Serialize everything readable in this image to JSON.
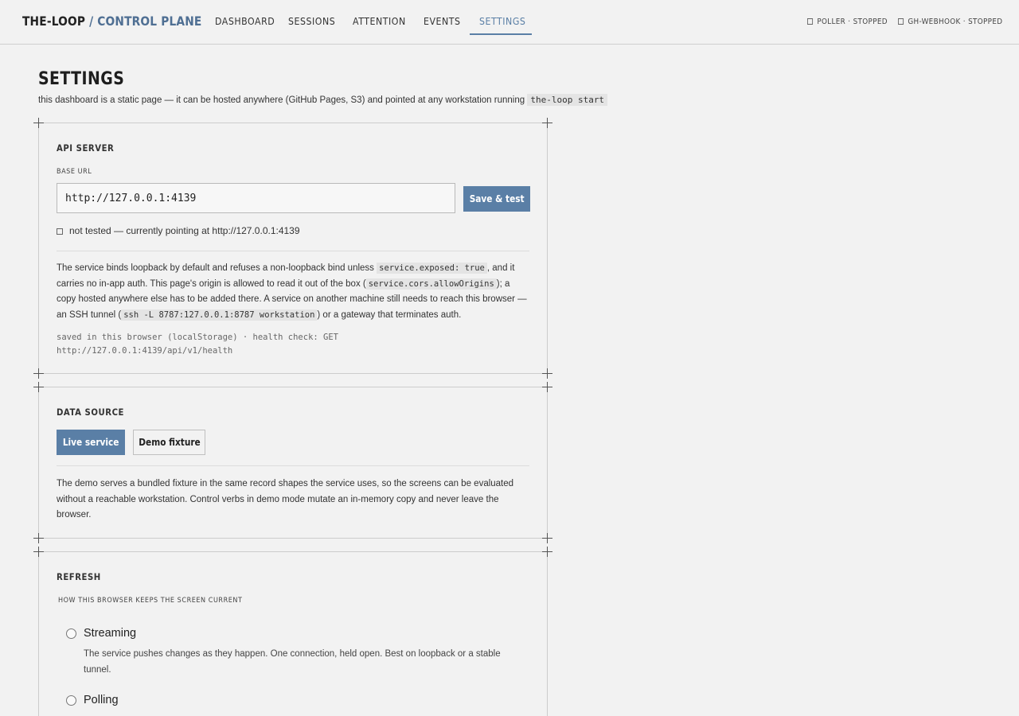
{
  "header": {
    "brand_main": "THE-LOOP",
    "brand_accent": "/ CONTROL PLANE",
    "nav": [
      "DASHBOARD",
      "SESSIONS",
      "ATTENTION",
      "EVENTS",
      "SETTINGS"
    ],
    "active_nav": "SETTINGS",
    "status": [
      "POLLER · STOPPED",
      "GH-WEBHOOK · STOPPED"
    ]
  },
  "page": {
    "title": "SETTINGS",
    "subtitle": "this dashboard is a static page — it can be hosted anywhere (GitHub Pages, S3) and pointed at any workstation running",
    "subtitle_code": "the-loop start"
  },
  "api_server": {
    "title": "API SERVER",
    "base_url_label": "BASE URL",
    "base_url_value": "http://127.0.0.1:4139",
    "save_label": "Save & test",
    "test_status": "not tested — currently pointing at http://127.0.0.1:4139",
    "info": {
      "t1": "The service binds loopback by default and refuses a non-loopback bind unless",
      "c1": "service.exposed: true",
      "t2": ", and it carries no in-app auth. This page's origin is allowed to read it out of the box (",
      "c2": "service.cors.allowOrigins",
      "t3": "); a copy hosted anywhere else has to be added there. A service on another machine still needs to reach this browser — an SSH tunnel (",
      "c3": "ssh -L 8787:127.0.0.1:8787 workstation",
      "t4": ") or a gateway that terminates auth."
    },
    "note": "saved in this browser (localStorage) · health check: GET http://127.0.0.1:4139/api/v1/health"
  },
  "data_source": {
    "title": "DATA SOURCE",
    "live_label": "Live service",
    "demo_label": "Demo fixture",
    "selected": "Live service",
    "info": "The demo serves a bundled fixture in the same record shapes the service uses, so the screens can be evaluated without a reachable workstation. Control verbs in demo mode mutate an in-memory copy and never leave the browser."
  },
  "refresh": {
    "title": "REFRESH",
    "subtitle": "HOW THIS BROWSER KEEPS THE SCREEN CURRENT",
    "options": [
      {
        "label": "Streaming",
        "description": "The service pushes changes as they happen. One connection, held open. Best on loopback or a stable tunnel."
      },
      {
        "label": "Polling",
        "description": ""
      }
    ]
  }
}
